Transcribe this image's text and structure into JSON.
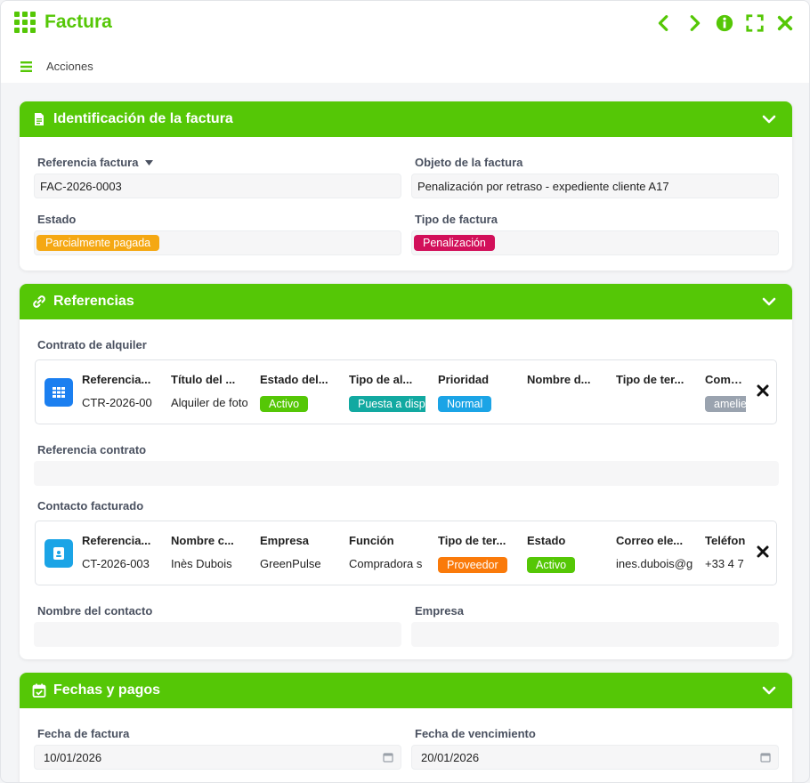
{
  "window": {
    "title": "Factura",
    "menu_label": "Acciones"
  },
  "colors": {
    "accent": "#55c706"
  },
  "sections": {
    "identificacion": {
      "title": "Identificación de la factura",
      "referencia_label": "Referencia factura",
      "referencia_value": "FAC-2026-0003",
      "objeto_label": "Objeto de la factura",
      "objeto_value": "Penalización por retraso - expediente cliente A17",
      "estado_label": "Estado",
      "estado_value": "Parcialmente pagada",
      "tipo_label": "Tipo de factura",
      "tipo_value": "Penalización"
    },
    "referencias": {
      "title": "Referencias",
      "contrato_label": "Contrato de alquiler",
      "contrato": {
        "headers": [
          "Referencia...",
          "Título del ...",
          "Estado del...",
          "Tipo de al...",
          "Prioridad",
          "Nombre d...",
          "Tipo de ter...",
          "Comerc"
        ],
        "values": [
          "CTR-2026-00",
          "Alquiler de foto",
          "Activo",
          "Puesta a disp",
          "Normal",
          "",
          "",
          "amelie"
        ]
      },
      "ref_contrato_label": "Referencia contrato",
      "contacto_label": "Contacto facturado",
      "contacto": {
        "headers": [
          "Referencia...",
          "Nombre c...",
          "Empresa",
          "Función",
          "Tipo de ter...",
          "Estado",
          "Correo ele...",
          "Teléfon"
        ],
        "values": [
          "CT-2026-003",
          "Inès Dubois",
          "GreenPulse",
          "Compradora s",
          "Proveedor",
          "Activo",
          "ines.dubois@g",
          "+33 4 7"
        ]
      },
      "nombre_contacto_label": "Nombre del contacto",
      "empresa_label": "Empresa"
    },
    "fechas": {
      "title": "Fechas y pagos",
      "fecha_factura_label": "Fecha de factura",
      "fecha_factura_value": "10/01/2026",
      "fecha_venc_label": "Fecha de vencimiento",
      "fecha_venc_value": "20/01/2026"
    }
  }
}
